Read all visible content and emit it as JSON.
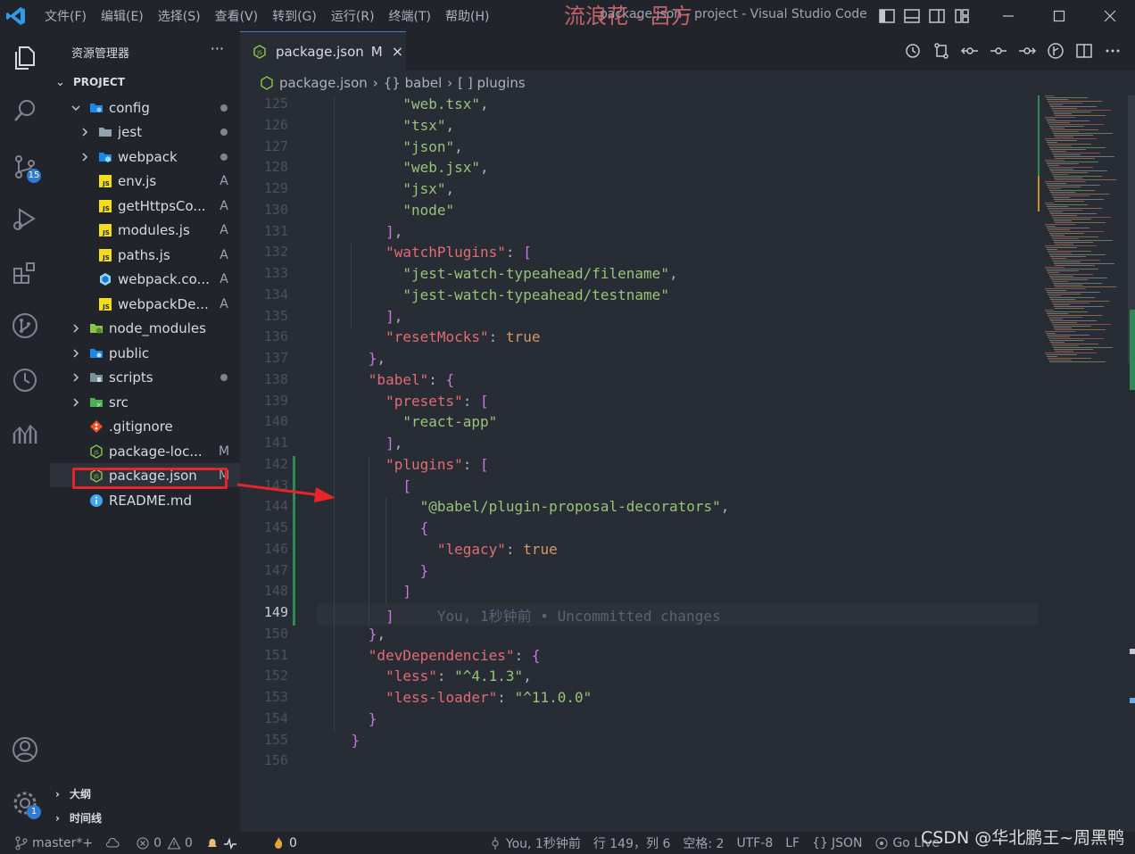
{
  "titlebar": {
    "menu": [
      "文件(F)",
      "编辑(E)",
      "选择(S)",
      "查看(V)",
      "转到(G)",
      "运行(R)",
      "终端(T)",
      "帮助(H)"
    ],
    "window_title": "package.json - project - Visual Studio Code",
    "watermark": "流浪花 - 吕方"
  },
  "activity_bar": {
    "source_control_badge": "15",
    "settings_badge": "1"
  },
  "sidebar": {
    "title": "资源管理器",
    "more": "···",
    "project_label": "PROJECT",
    "tree": [
      {
        "name": "config",
        "status": "",
        "dot": true
      },
      {
        "name": "jest",
        "status": "",
        "dot": true
      },
      {
        "name": "webpack",
        "status": "",
        "dot": true
      },
      {
        "name": "env.js",
        "status": "A",
        "dot": false
      },
      {
        "name": "getHttpsCo...",
        "status": "A",
        "dot": false
      },
      {
        "name": "modules.js",
        "status": "A",
        "dot": false
      },
      {
        "name": "paths.js",
        "status": "A",
        "dot": false
      },
      {
        "name": "webpack.co...",
        "status": "A",
        "dot": false
      },
      {
        "name": "webpackDe...",
        "status": "A",
        "dot": false
      },
      {
        "name": "node_modules",
        "status": "",
        "dot": false
      },
      {
        "name": "public",
        "status": "",
        "dot": false
      },
      {
        "name": "scripts",
        "status": "",
        "dot": true
      },
      {
        "name": "src",
        "status": "",
        "dot": false
      },
      {
        "name": ".gitignore",
        "status": "",
        "dot": false
      },
      {
        "name": "package-loc...",
        "status": "M",
        "dot": false
      },
      {
        "name": "package.json",
        "status": "M",
        "dot": false
      },
      {
        "name": "README.md",
        "status": "",
        "dot": false
      }
    ],
    "outline_label": "大纲",
    "timeline_label": "时间线"
  },
  "editor": {
    "tab": {
      "name": "package.json",
      "status": "M",
      "close": "×"
    },
    "breadcrumb": [
      "package.json",
      "{} babel",
      "[ ] plugins"
    ],
    "current_line": "149",
    "blame": "You, 1秒钟前 • Uncommitted changes",
    "lines": [
      {
        "n": "125",
        "code": "          \"web.tsx\","
      },
      {
        "n": "126",
        "code": "          \"tsx\","
      },
      {
        "n": "127",
        "code": "          \"json\","
      },
      {
        "n": "128",
        "code": "          \"web.jsx\","
      },
      {
        "n": "129",
        "code": "          \"jsx\","
      },
      {
        "n": "130",
        "code": "          \"node\""
      },
      {
        "n": "131",
        "code": "        ],"
      },
      {
        "n": "132",
        "code": "        \"watchPlugins\": ["
      },
      {
        "n": "133",
        "code": "          \"jest-watch-typeahead/filename\","
      },
      {
        "n": "134",
        "code": "          \"jest-watch-typeahead/testname\""
      },
      {
        "n": "135",
        "code": "        ],"
      },
      {
        "n": "136",
        "code": "        \"resetMocks\": true"
      },
      {
        "n": "137",
        "code": "      },"
      },
      {
        "n": "138",
        "code": "      \"babel\": {"
      },
      {
        "n": "139",
        "code": "        \"presets\": ["
      },
      {
        "n": "140",
        "code": "          \"react-app\""
      },
      {
        "n": "141",
        "code": "        ],"
      },
      {
        "n": "142",
        "code": "        \"plugins\": ["
      },
      {
        "n": "143",
        "code": "          ["
      },
      {
        "n": "144",
        "code": "            \"@babel/plugin-proposal-decorators\","
      },
      {
        "n": "145",
        "code": "            {"
      },
      {
        "n": "146",
        "code": "              \"legacy\": true"
      },
      {
        "n": "147",
        "code": "            }"
      },
      {
        "n": "148",
        "code": "          ]"
      },
      {
        "n": "149",
        "code": "        ]"
      },
      {
        "n": "150",
        "code": "      },"
      },
      {
        "n": "151",
        "code": "      \"devDependencies\": {"
      },
      {
        "n": "152",
        "code": "        \"less\": \"^4.1.3\","
      },
      {
        "n": "153",
        "code": "        \"less-loader\": \"^11.0.0\""
      },
      {
        "n": "154",
        "code": "      }"
      },
      {
        "n": "155",
        "code": "    }"
      },
      {
        "n": "156",
        "code": ""
      }
    ]
  },
  "statusbar": {
    "branch": "master*+",
    "errors": "0",
    "warnings": "0",
    "notifications": "0",
    "blame": "You, 1秒钟前",
    "position": "行 149，列 6",
    "spaces": "空格: 2",
    "encoding": "UTF-8",
    "eol": "LF",
    "language": "JSON",
    "go_live": "Go Live",
    "watermark": "CSDN @华北鹏王~周黑鸭"
  },
  "colors": {
    "accent": "#4d78cc",
    "key": "#e06c75",
    "string": "#98c379",
    "boolean": "#d19a66",
    "highlight_box": "#e8242b"
  }
}
